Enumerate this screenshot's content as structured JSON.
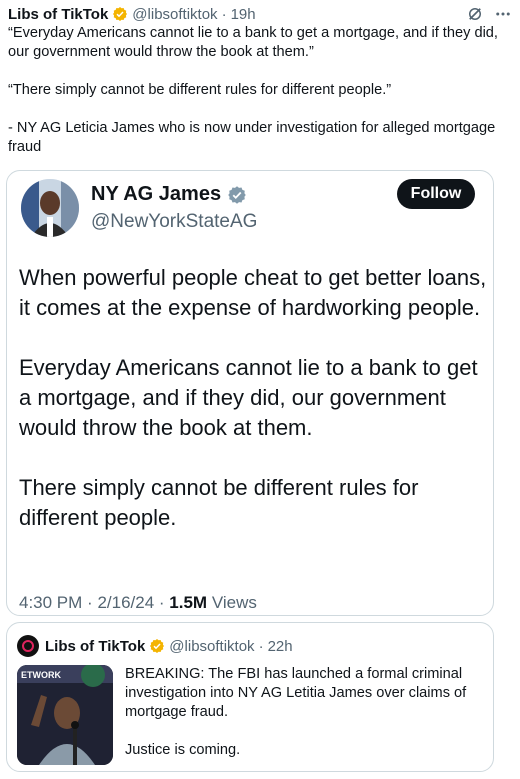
{
  "post": {
    "display_name": "Libs of TikTok",
    "handle": "@libsoftiktok",
    "time": "19h",
    "paragraphs": [
      "“Everyday Americans cannot lie to a bank to get a mortgage, and if they did, our government would throw the book at them.”",
      "“There simply cannot be different rules for different people.”",
      "- NY AG Leticia James who is now under investigation for alleged mortgage fraud"
    ],
    "separator": "·"
  },
  "quote": {
    "display_name": "NY AG James",
    "handle": "@NewYorkStateAG",
    "follow_label": "Follow",
    "paragraphs": [
      "When powerful people cheat to get better loans, it comes at the expense of hardworking people.",
      "Everyday Americans cannot lie to a bank to get a mortgage, and if they did, our government would throw the book at them.",
      "There simply cannot be different rules for different people."
    ],
    "time": "4:30 PM",
    "date": "2/16/24",
    "views_count": "1.5M",
    "views_label": "Views"
  },
  "quote2": {
    "display_name": "Libs of TikTok",
    "handle": "@libsoftiktok",
    "time": "22h",
    "thumb_text": "ETWORK",
    "paragraphs": [
      "BREAKING: The FBI has launched a formal criminal investigation into NY AG Letitia James over claims of mortgage fraud.",
      "Justice is coming."
    ]
  },
  "colors": {
    "verified_badge": "#f4b400",
    "text_primary": "#0f1419",
    "text_secondary": "#536471",
    "border": "#cfd9de"
  },
  "icons": [
    "verified-badge-icon",
    "grok-icon",
    "more-icon"
  ]
}
